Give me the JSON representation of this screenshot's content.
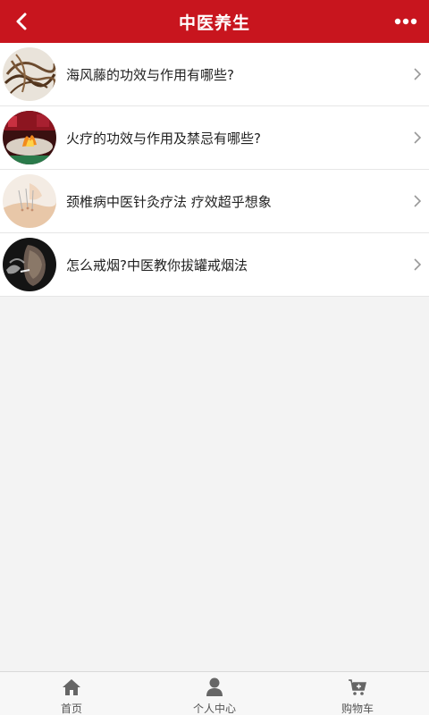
{
  "header": {
    "title": "中医养生",
    "back_icon": "back-arrow-icon",
    "more_icon": "more-dots-icon",
    "background_color": "#c8151e"
  },
  "articles": [
    {
      "title": "海风藤的功效与作用有哪些?",
      "thumbnail": "dried-vines-image"
    },
    {
      "title": "火疗的功效与作用及禁忌有哪些?",
      "thumbnail": "fire-therapy-image"
    },
    {
      "title": "颈椎病中医针灸疗法 疗效超乎想象",
      "thumbnail": "acupuncture-neck-image"
    },
    {
      "title": "怎么戒烟?中医教你拔罐戒烟法",
      "thumbnail": "smoking-person-image"
    }
  ],
  "bottom_nav": [
    {
      "label": "首页",
      "icon": "home-icon"
    },
    {
      "label": "个人中心",
      "icon": "user-icon"
    },
    {
      "label": "购物车",
      "icon": "cart-icon"
    }
  ]
}
